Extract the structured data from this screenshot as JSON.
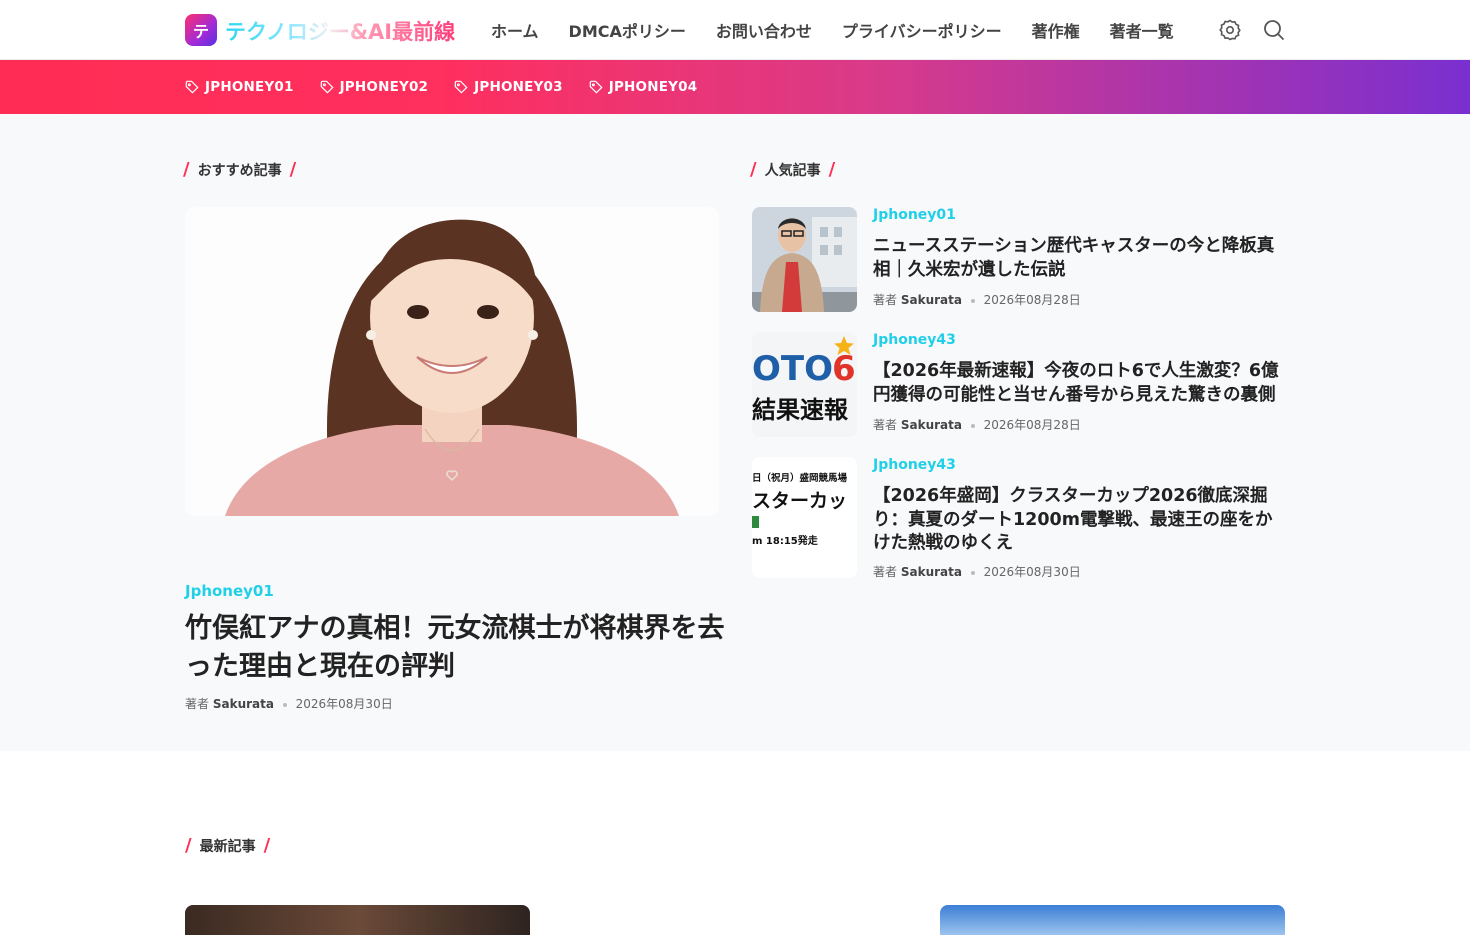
{
  "header": {
    "logo_char": "テ",
    "site_title": "テクノロジー&AI最前線",
    "menu": [
      "ホーム",
      "DMCAポリシー",
      "お問い合わせ",
      "プライバシーポリシー",
      "著作権",
      "著者一覧"
    ]
  },
  "tags": [
    "JPHONEY01",
    "JPHONEY02",
    "JPHONEY03",
    "JPHONEY04"
  ],
  "featured": {
    "label": "おすすめ記事",
    "category": "Jphoney01",
    "title": "竹俣紅アナの真相！元女流棋士が将棋界を去った理由と現在の評判",
    "author_prefix": "著者",
    "author": "Sakurata",
    "date": "2026年08月30日"
  },
  "popular": {
    "label": "人気記事",
    "items": [
      {
        "category": "Jphoney01",
        "title": "ニュースステーション歴代キャスターの今と降板真相｜久米宏が遺した伝説",
        "author_prefix": "著者",
        "author": "Sakurata",
        "date": "2026年08月28日"
      },
      {
        "category": "Jphoney43",
        "title": "【2026年最新速報】今夜のロト6で人生激変？6億円獲得の可能性と当せん番号から見えた驚きの裏側",
        "author_prefix": "著者",
        "author": "Sakurata",
        "date": "2026年08月28日",
        "thumb_text_1": "OTO",
        "thumb_text_2": "6",
        "thumb_text_3": "結果速報"
      },
      {
        "category": "Jphoney43",
        "title": "【2026年盛岡】クラスターカップ2026徹底深掘り：真夏のダート1200m電撃戦、最速王の座をかけた熱戦のゆくえ",
        "author_prefix": "著者",
        "author": "Sakurata",
        "date": "2026年08月30日",
        "thumb_text_1": "日（祝月）盛岡競馬場",
        "thumb_text_2": "スターカッ",
        "thumb_text_3": "m 18:15発走"
      }
    ]
  },
  "latest": {
    "label": "最新記事"
  },
  "colors": {
    "accent": "#ff2d55",
    "category": "#20d0e8",
    "purple": "#7a2fd0"
  }
}
